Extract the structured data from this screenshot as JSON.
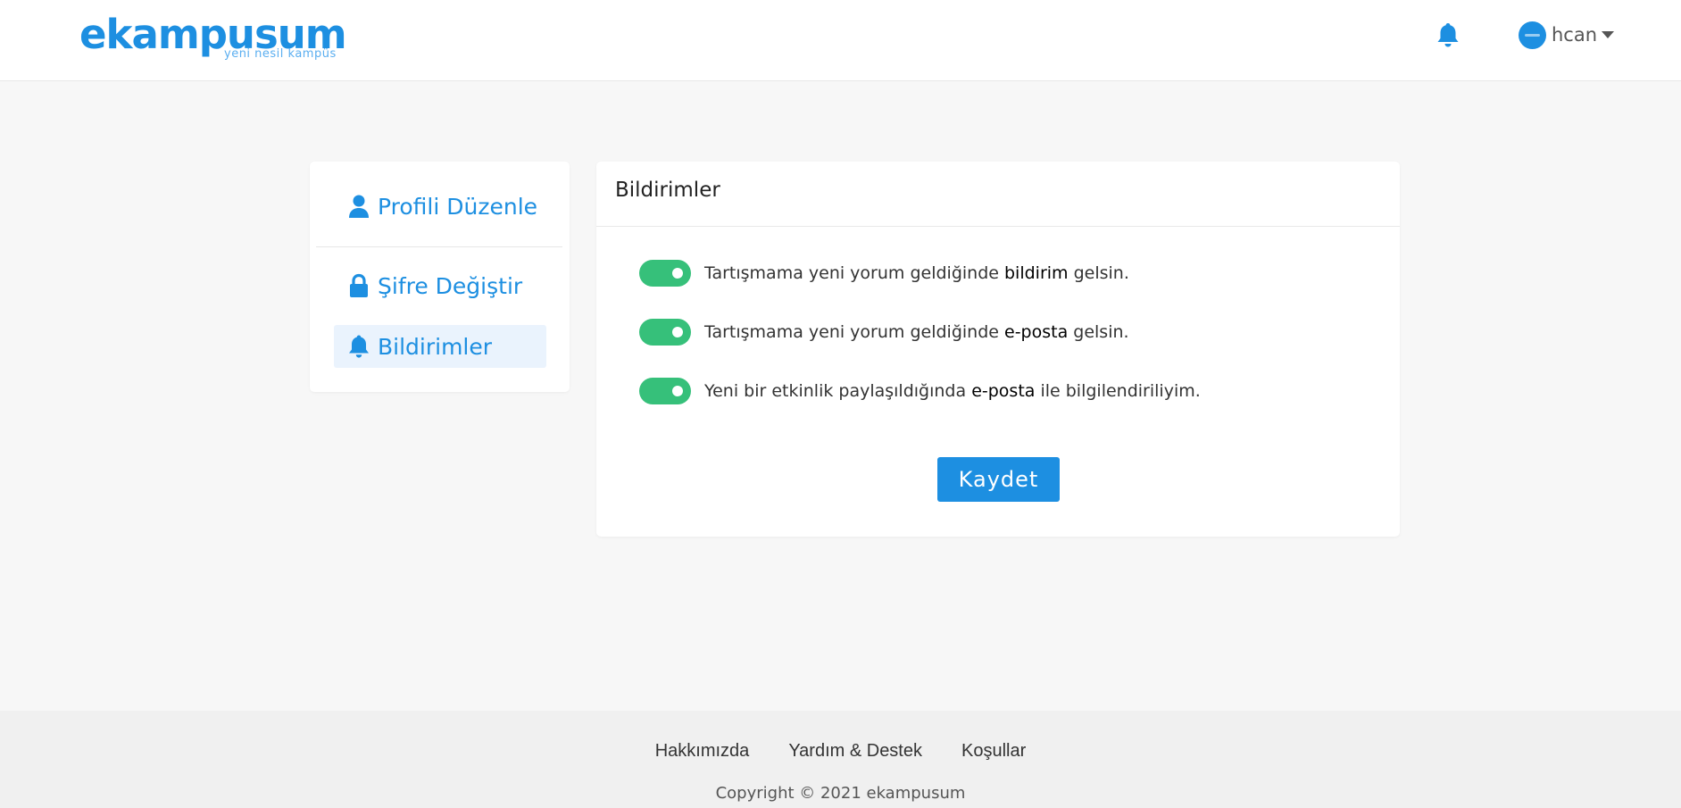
{
  "header": {
    "logo_main": "ekampusum",
    "logo_sub": "yeni nesil kampüs",
    "username": "hcan",
    "colors": {
      "brand": "#1d8fe1"
    }
  },
  "sidebar": {
    "items": [
      {
        "label": "Profili Düzenle",
        "icon": "user-icon"
      },
      {
        "label": "Şifre Değiştir",
        "icon": "lock-icon"
      },
      {
        "label": "Bildirimler",
        "icon": "bell-icon",
        "active": true
      }
    ]
  },
  "main": {
    "title": "Bildirimler",
    "settings": [
      {
        "pre": "Tartışmama yeni yorum geldiğinde ",
        "bold": "bildirim",
        "post": " gelsin.",
        "enabled": true
      },
      {
        "pre": "Tartışmama yeni yorum geldiğinde ",
        "bold": "e-posta",
        "post": " gelsin.",
        "enabled": true
      },
      {
        "pre": "Yeni bir etkinlik paylaşıldığında ",
        "bold": "e-posta",
        "post": " ile bilgilendiriliyim.",
        "enabled": true
      }
    ],
    "save_label": "Kaydet",
    "colors": {
      "toggle_on": "#36c07a",
      "button": "#1d8fe1"
    }
  },
  "footer": {
    "links": [
      "Hakkımızda",
      "Yardım & Destek",
      "Koşullar"
    ],
    "copyright": "Copyright © 2021 ekampusum"
  }
}
